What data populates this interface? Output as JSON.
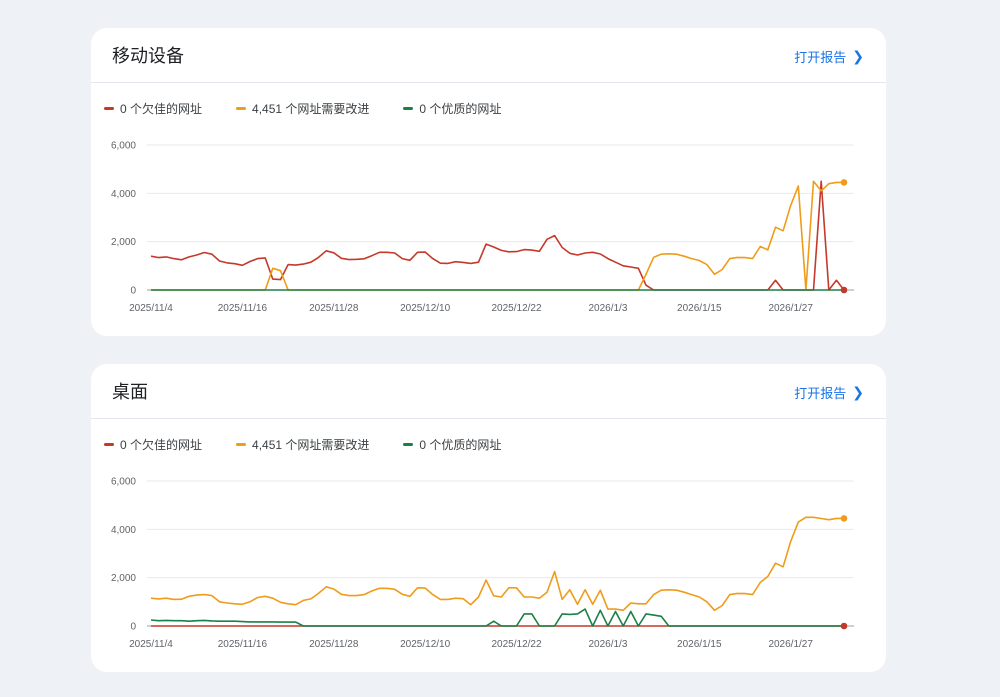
{
  "colors": {
    "poor": "#c5392a",
    "improve": "#ef9c1a",
    "good": "#1a8045",
    "link": "#1a73e8"
  },
  "cards": [
    {
      "title": "移动设备",
      "open_label": "打开报告",
      "legend": [
        "0 个欠佳的网址",
        "4,451 个网址需要改进",
        "0 个优质的网址"
      ]
    },
    {
      "title": "桌面",
      "open_label": "打开报告",
      "legend": [
        "0 个欠佳的网址",
        "4,451 个网址需要改进",
        "0 个优质的网址"
      ]
    }
  ],
  "chart_data": [
    {
      "type": "line",
      "x_labels": [
        "2025/11/4",
        "2025/11/16",
        "2025/11/28",
        "2025/12/10",
        "2025/12/22",
        "2026/1/3",
        "2026/1/15",
        "2026/1/27"
      ],
      "x_label_index": [
        0,
        12,
        24,
        36,
        48,
        60,
        72,
        84
      ],
      "y_ticks": [
        "0",
        "2,000",
        "4,000",
        "6,000"
      ],
      "ylim": [
        0,
        6000
      ],
      "grid": true,
      "n_points": 92,
      "series": [
        {
          "name": "0 个欠佳的网址",
          "color": "#c5392a",
          "values": [
            1400,
            1340,
            1370,
            1300,
            1250,
            1370,
            1450,
            1550,
            1480,
            1200,
            1120,
            1090,
            1020,
            1180,
            1300,
            1330,
            450,
            430,
            1050,
            1030,
            1070,
            1150,
            1350,
            1620,
            1540,
            1310,
            1260,
            1270,
            1290,
            1420,
            1560,
            1560,
            1530,
            1300,
            1230,
            1560,
            1570,
            1300,
            1110,
            1100,
            1170,
            1140,
            1100,
            1150,
            1900,
            1780,
            1640,
            1580,
            1590,
            1670,
            1650,
            1600,
            2100,
            2250,
            1760,
            1520,
            1450,
            1530,
            1560,
            1490,
            1300,
            1150,
            1000,
            950,
            900,
            200,
            0,
            0,
            0,
            0,
            0,
            0,
            0,
            0,
            0,
            0,
            0,
            0,
            0,
            0,
            0,
            0,
            400,
            0,
            0,
            0,
            0,
            0,
            4500,
            0,
            400,
            0
          ]
        },
        {
          "name": "4,451 个网址需要改进",
          "color": "#ef9c1a",
          "values": [
            0,
            0,
            0,
            0,
            0,
            0,
            0,
            0,
            0,
            0,
            0,
            0,
            0,
            0,
            0,
            0,
            900,
            800,
            0,
            0,
            0,
            0,
            0,
            0,
            0,
            0,
            0,
            0,
            0,
            0,
            0,
            0,
            0,
            0,
            0,
            0,
            0,
            0,
            0,
            0,
            0,
            0,
            0,
            0,
            0,
            0,
            0,
            0,
            0,
            0,
            0,
            0,
            0,
            0,
            0,
            0,
            0,
            0,
            0,
            0,
            0,
            0,
            0,
            0,
            0,
            650,
            1350,
            1480,
            1500,
            1480,
            1400,
            1300,
            1220,
            1050,
            650,
            850,
            1300,
            1350,
            1340,
            1300,
            1800,
            1660,
            2600,
            2450,
            3500,
            4300,
            0,
            4500,
            4100,
            4400,
            4451,
            4451
          ]
        },
        {
          "name": "0 个优质的网址",
          "color": "#1a8045",
          "values": [
            0,
            0,
            0,
            0,
            0,
            0,
            0,
            0,
            0,
            0,
            0,
            0,
            0,
            0,
            0,
            0,
            0,
            0,
            0,
            0,
            0,
            0,
            0,
            0,
            0,
            0,
            0,
            0,
            0,
            0,
            0,
            0,
            0,
            0,
            0,
            0,
            0,
            0,
            0,
            0,
            0,
            0,
            0,
            0,
            0,
            0,
            0,
            0,
            0,
            0,
            0,
            0,
            0,
            0,
            0,
            0,
            0,
            0,
            0,
            0,
            0,
            0,
            0,
            0,
            0,
            0,
            0,
            0,
            0,
            0,
            0,
            0,
            0,
            0,
            0,
            0,
            0,
            0,
            0,
            0,
            0,
            0,
            0,
            0,
            0,
            0,
            0,
            0,
            0,
            0,
            0,
            0
          ]
        }
      ]
    },
    {
      "type": "line",
      "x_labels": [
        "2025/11/4",
        "2025/11/16",
        "2025/11/28",
        "2025/12/10",
        "2025/12/22",
        "2026/1/3",
        "2026/1/15",
        "2026/1/27"
      ],
      "x_label_index": [
        0,
        12,
        24,
        36,
        48,
        60,
        72,
        84
      ],
      "y_ticks": [
        "0",
        "2,000",
        "4,000",
        "6,000"
      ],
      "ylim": [
        0,
        6000
      ],
      "grid": true,
      "n_points": 92,
      "series": [
        {
          "name": "0 个欠佳的网址",
          "color": "#c5392a",
          "values": [
            0,
            0,
            0,
            0,
            0,
            0,
            0,
            0,
            0,
            0,
            0,
            0,
            0,
            0,
            0,
            0,
            0,
            0,
            0,
            0,
            0,
            0,
            0,
            0,
            0,
            0,
            0,
            0,
            0,
            0,
            0,
            0,
            0,
            0,
            0,
            0,
            0,
            0,
            0,
            0,
            0,
            0,
            0,
            0,
            0,
            0,
            0,
            0,
            0,
            0,
            0,
            0,
            0,
            0,
            0,
            0,
            0,
            0,
            0,
            0,
            0,
            0,
            0,
            0,
            0,
            0,
            0,
            0,
            0,
            0,
            0,
            0,
            0,
            0,
            0,
            0,
            0,
            0,
            0,
            0,
            0,
            0,
            0,
            0,
            0,
            0,
            0,
            0,
            0,
            0,
            0,
            0
          ]
        },
        {
          "name": "4,451 个网址需要改进",
          "color": "#ef9c1a",
          "values": [
            1150,
            1120,
            1150,
            1100,
            1110,
            1230,
            1280,
            1300,
            1260,
            1000,
            950,
            920,
            900,
            1000,
            1180,
            1230,
            1150,
            980,
            920,
            880,
            1060,
            1120,
            1350,
            1620,
            1530,
            1310,
            1260,
            1260,
            1300,
            1450,
            1560,
            1560,
            1520,
            1310,
            1230,
            1580,
            1570,
            1300,
            1100,
            1100,
            1150,
            1130,
            880,
            1200,
            1900,
            1250,
            1200,
            1580,
            1580,
            1200,
            1200,
            1150,
            1400,
            2250,
            1100,
            1500,
            900,
            1500,
            900,
            1480,
            700,
            700,
            650,
            950,
            920,
            920,
            1300,
            1480,
            1500,
            1480,
            1400,
            1300,
            1200,
            1000,
            650,
            850,
            1300,
            1350,
            1340,
            1300,
            1800,
            2050,
            2600,
            2450,
            3500,
            4300,
            4500,
            4500,
            4450,
            4400,
            4451,
            4451
          ]
        },
        {
          "name": "0 个优质的网址",
          "color": "#1a8045",
          "values": [
            250,
            220,
            230,
            220,
            220,
            200,
            220,
            230,
            210,
            200,
            200,
            200,
            180,
            170,
            170,
            170,
            170,
            160,
            160,
            160,
            0,
            0,
            0,
            0,
            0,
            0,
            0,
            0,
            0,
            0,
            0,
            0,
            0,
            0,
            0,
            0,
            0,
            0,
            0,
            0,
            0,
            0,
            0,
            0,
            0,
            200,
            0,
            0,
            0,
            500,
            500,
            0,
            0,
            0,
            500,
            480,
            500,
            700,
            0,
            650,
            0,
            600,
            0,
            600,
            0,
            500,
            450,
            400,
            0,
            0,
            0,
            0,
            0,
            0,
            0,
            0,
            0,
            0,
            0,
            0,
            0,
            0,
            0,
            0,
            0,
            0,
            0,
            0,
            0,
            0,
            0,
            0
          ]
        }
      ]
    }
  ]
}
